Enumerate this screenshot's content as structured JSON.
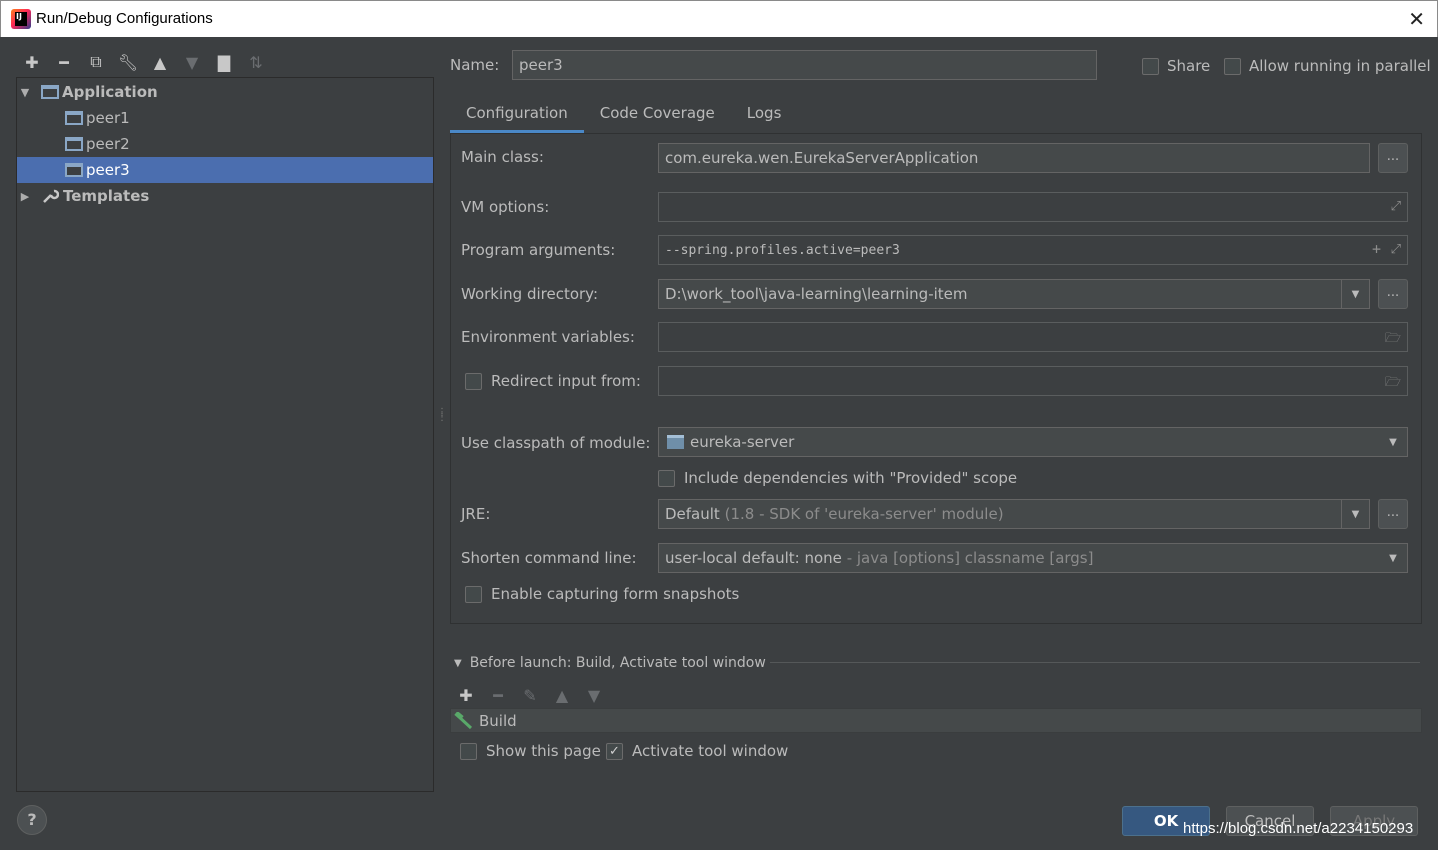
{
  "window": {
    "title": "Run/Debug Configurations"
  },
  "tree": {
    "application": "Application",
    "items": [
      "peer1",
      "peer2",
      "peer3"
    ],
    "templates": "Templates"
  },
  "name": {
    "label": "Name:",
    "value": "peer3"
  },
  "options": {
    "share": "Share",
    "allow_parallel": "Allow running in parallel"
  },
  "tabs": [
    "Configuration",
    "Code Coverage",
    "Logs"
  ],
  "fields": {
    "main_class_label": "Main class:",
    "main_class": "com.eureka.wen.EurekaServerApplication",
    "vm_options_label": "VM options:",
    "vm_options": "",
    "program_args_label": "Program arguments:",
    "program_args": "--spring.profiles.active=peer3",
    "working_dir_label": "Working directory:",
    "working_dir": "D:\\work_tool\\java-learning\\learning-item",
    "env_vars_label": "Environment variables:",
    "env_vars": "",
    "redirect_label": "Redirect input from:",
    "classpath_label": "Use classpath of module:",
    "classpath_module": "eureka-server",
    "include_deps": "Include dependencies with \"Provided\" scope",
    "jre_label": "JRE:",
    "jre_main": "Default",
    "jre_detail": "(1.8 - SDK of 'eureka-server' module)",
    "shorten_label": "Shorten command line:",
    "shorten_main": "user-local default: none",
    "shorten_detail": "- java [options] classname [args]",
    "snapshots": "Enable capturing form snapshots",
    "dots": "..."
  },
  "before_launch": {
    "header": "Before launch: Build, Activate tool window",
    "items": [
      "Build"
    ],
    "show_page": "Show this page",
    "activate_tool": "Activate tool window"
  },
  "buttons": {
    "ok": "OK",
    "cancel": "Cancel",
    "apply": "Apply",
    "help": "?"
  },
  "watermark": "https://blog.csdn.net/a2234150293",
  "colors": {
    "background": "#3c3f41",
    "selection": "#4b6eaf",
    "accent": "#4a88c7",
    "ok_button": "#365880"
  }
}
